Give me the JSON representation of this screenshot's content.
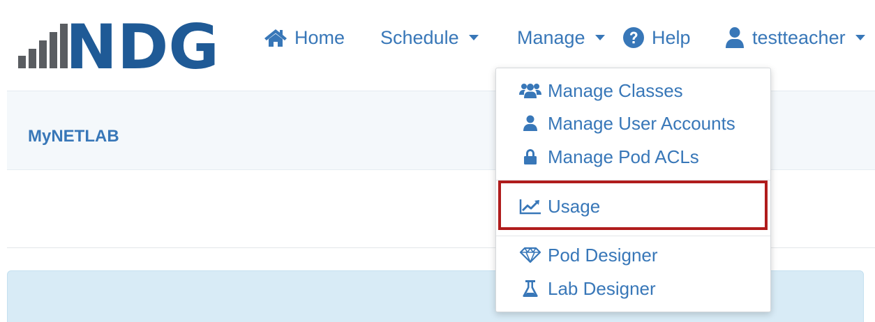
{
  "brand": {
    "logo_text": "NDG",
    "app_name": "MyNETLAB"
  },
  "nav": {
    "home": {
      "label": "Home",
      "icon": "home-icon"
    },
    "schedule": {
      "label": "Schedule",
      "icon": "caret-down-icon"
    },
    "manage": {
      "label": "Manage",
      "icon": "caret-down-icon"
    },
    "help": {
      "label": "Help",
      "icon": "question-circle-icon"
    },
    "user": {
      "label": "testteacher",
      "icon": "user-icon"
    }
  },
  "manage_menu": {
    "items": [
      {
        "label": "Manage Classes",
        "icon": "users-group-icon"
      },
      {
        "label": "Manage User Accounts",
        "icon": "user-icon"
      },
      {
        "label": "Manage Pod ACLs",
        "icon": "lock-icon"
      },
      {
        "label": "Usage",
        "icon": "line-chart-icon",
        "highlighted": true
      },
      {
        "label": "Pod Designer",
        "icon": "diamond-icon"
      },
      {
        "label": "Lab Designer",
        "icon": "flask-icon"
      }
    ]
  },
  "colors": {
    "link": "#3877b8",
    "logo_blue": "#1f5a96",
    "logo_gray": "#5a5d61",
    "highlight_border": "#b01c1c",
    "info_panel": "#d8ebf6",
    "brand_strip": "#f4f8fb"
  }
}
